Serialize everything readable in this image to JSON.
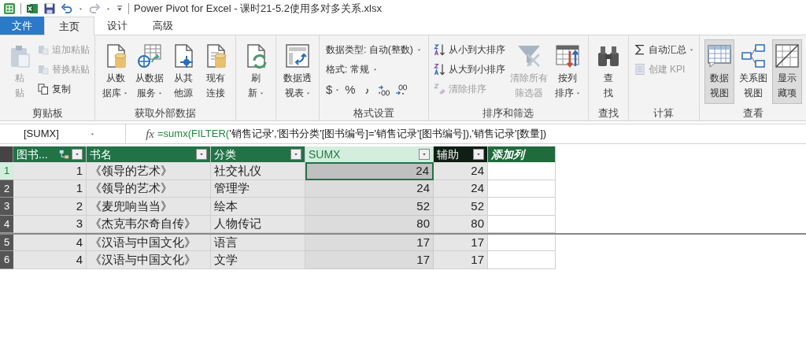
{
  "title_bar": {
    "title": "Power Pivot for Excel - 课时21-5.2使用多对多关系.xlsx"
  },
  "tabs": [
    {
      "label": "文件",
      "kind": "file",
      "selected": false
    },
    {
      "label": "主页",
      "kind": "tab",
      "selected": true
    },
    {
      "label": "设计",
      "kind": "tab",
      "selected": false
    },
    {
      "label": "高级",
      "kind": "tab",
      "selected": false
    }
  ],
  "ribbon": {
    "groups": [
      {
        "label": "剪贴板",
        "columns": [
          [
            {
              "kind": "large",
              "lines": [
                "粘",
                "贴"
              ],
              "disabled": true
            }
          ],
          [
            {
              "kind": "small",
              "label": "追加粘贴",
              "disabled": true
            },
            {
              "kind": "small",
              "label": "替换粘贴",
              "disabled": true
            },
            {
              "kind": "small",
              "label": "复制",
              "disabled": false
            }
          ]
        ]
      },
      {
        "label": "获取外部数据",
        "columns": [
          [
            {
              "kind": "large",
              "lines": [
                "从数",
                "据库"
              ],
              "dropdown": true
            }
          ],
          [
            {
              "kind": "large",
              "lines": [
                "从数据",
                "服务"
              ],
              "dropdown": true
            }
          ],
          [
            {
              "kind": "large",
              "lines": [
                "从其",
                "他源"
              ]
            }
          ],
          [
            {
              "kind": "large",
              "lines": [
                "现有",
                "连接"
              ]
            }
          ]
        ]
      },
      {
        "columns": [
          [
            {
              "kind": "large",
              "lines": [
                "刷",
                "新"
              ],
              "dropdown": true
            }
          ]
        ]
      },
      {
        "columns": [
          [
            {
              "kind": "large",
              "lines": [
                "数据透",
                "视表"
              ],
              "dropdown": true
            }
          ]
        ]
      },
      {
        "label": "格式设置",
        "columns": [
          [
            {
              "kind": "field",
              "label": "数据类型: 自动(整数)",
              "dropdown": true
            },
            {
              "kind": "field",
              "label": "格式: 常规",
              "dropdown": true
            },
            {
              "kind": "row",
              "items": [
                {
                  "kind": "symbol",
                  "text": "$",
                  "dropdown": true
                },
                {
                  "kind": "symbol",
                  "text": "%"
                },
                {
                  "kind": "tool"
                },
                {
                  "kind": "tool"
                },
                {
                  "kind": "tool"
                }
              ]
            }
          ]
        ]
      },
      {
        "label": "排序和筛选",
        "columns": [
          [
            {
              "kind": "small",
              "label": "从小到大排序",
              "disabled": false
            },
            {
              "kind": "small",
              "label": "从大到小排序",
              "disabled": false
            },
            {
              "kind": "small",
              "label": "清除排序",
              "disabled": true
            }
          ],
          [
            {
              "kind": "large",
              "lines": [
                "清除所有",
                "筛选器"
              ],
              "disabled": true
            }
          ],
          [
            {
              "kind": "large",
              "lines": [
                "按列",
                "排序"
              ],
              "dropdown": true
            }
          ]
        ]
      },
      {
        "label": "查找",
        "columns": [
          [
            {
              "kind": "large",
              "lines": [
                "查",
                "找"
              ]
            }
          ]
        ]
      },
      {
        "label": "计算",
        "columns": [
          [
            {
              "kind": "small",
              "label": "自动汇总",
              "dropdown": true,
              "disabled": false
            },
            {
              "kind": "small",
              "label": "创建 KPI",
              "disabled": true
            }
          ]
        ]
      },
      {
        "label": "查看",
        "columns": [
          [
            {
              "kind": "large",
              "lines": [
                "数据",
                "视图"
              ],
              "selected": true
            }
          ],
          [
            {
              "kind": "large",
              "lines": [
                "关系图",
                "视图"
              ],
              "selected": false
            }
          ],
          [
            {
              "kind": "large",
              "lines": [
                "显示",
                "藏项"
              ],
              "selected": true
            }
          ]
        ]
      }
    ]
  },
  "formula_bar": {
    "name_box": "[SUMX]",
    "fx": "fx",
    "formula": [
      {
        "text": "=sumx(",
        "kind": "function"
      },
      {
        "text": "FILTER(",
        "kind": "function"
      },
      {
        "text": "'销售记录','图书分类'[图书编号]='销售记录'[图书编号]),'销售记录'[数量])",
        "kind": "plain"
      }
    ]
  },
  "table": {
    "columns": [
      {
        "label": "图书...",
        "kind": "data",
        "relationship": true,
        "selected": false,
        "hover": false
      },
      {
        "label": "书名",
        "kind": "data",
        "selected": false,
        "hover": false
      },
      {
        "label": "分类",
        "kind": "data",
        "selected": false,
        "hover": false
      },
      {
        "label": "SUMX",
        "kind": "data",
        "selected": true,
        "hover": false
      },
      {
        "label": "辅助",
        "kind": "data",
        "selected": false,
        "hover": true
      },
      {
        "label": "添加列",
        "kind": "add"
      }
    ],
    "rows": [
      {
        "number": "1",
        "selected": true,
        "cells": [
          "1",
          "《领导的艺术》",
          "社交礼仪",
          "24",
          "24"
        ],
        "selected_cells": [
          false,
          false,
          false,
          true,
          false
        ]
      },
      {
        "number": "2",
        "selected": false,
        "cells": [
          "1",
          "《领导的艺术》",
          "管理学",
          "24",
          "24"
        ]
      },
      {
        "number": "3",
        "selected": false,
        "cells": [
          "2",
          "《麦兜响当当》",
          "绘本",
          "52",
          "52"
        ]
      },
      {
        "number": "4",
        "selected": false,
        "cells": [
          "3",
          "《杰克韦尔奇自传》",
          "人物传记",
          "80",
          "80"
        ]
      },
      {
        "number": "5",
        "selected": false,
        "cells": [
          "4",
          "《汉语与中国文化》",
          "语言",
          "17",
          "17"
        ]
      },
      {
        "number": "6",
        "selected": false,
        "cells": [
          "4",
          "《汉语与中国文化》",
          "文学",
          "17",
          "17"
        ]
      }
    ]
  }
}
